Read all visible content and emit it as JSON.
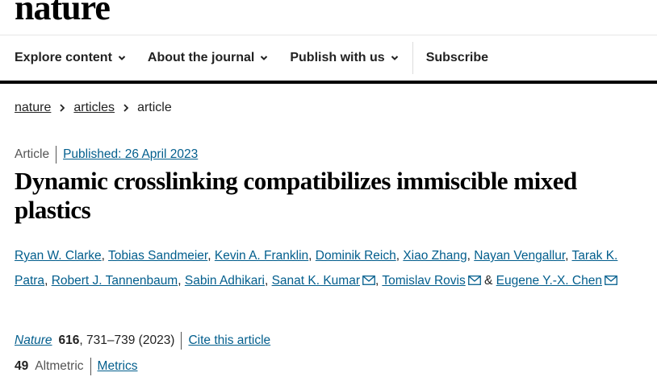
{
  "brand": {
    "logo_text": "nature"
  },
  "nav": {
    "items": [
      {
        "label": "Explore content",
        "icon": "chevron-down-icon"
      },
      {
        "label": "About the journal",
        "icon": "chevron-down-icon"
      },
      {
        "label": "Publish with us",
        "icon": "chevron-down-icon"
      }
    ],
    "subscribe_label": "Subscribe"
  },
  "breadcrumb": {
    "items": [
      "nature",
      "articles",
      "article"
    ],
    "separator_icon": "chevron-right-icon"
  },
  "article": {
    "type": "Article",
    "published": "Published: 26 April 2023",
    "title": "Dynamic crosslinking compatibilizes immiscible mixed plastics",
    "authors": {
      "a1": "Ryan W. Clarke",
      "a2": "Tobias Sandmeier",
      "a3": "Kevin A. Franklin",
      "a4": "Dominik Reich",
      "a5": "Xiao Zhang",
      "a6": "Nayan Vengallur",
      "a7": "Tarak K. Patra",
      "a8": "Robert J. Tannenbaum",
      "a9": "Sabin Adhikari",
      "a10": "Sanat K. Kumar",
      "a11": "Tomislav Rovis",
      "a12": "Eugene Y.-X. Chen",
      "ampersand": "&",
      "mail_icon": "envelope-icon"
    },
    "citation": {
      "journal": "Nature",
      "volume": "616",
      "pages_year": ", 731–739 (2023)",
      "cite_link": "Cite this article"
    },
    "metrics": {
      "altmetric_score": "49",
      "altmetric_label": "Altmetric",
      "metrics_link": "Metrics"
    }
  },
  "colors": {
    "link": "#025e8d",
    "text": "#222222",
    "rule": "#000000"
  }
}
